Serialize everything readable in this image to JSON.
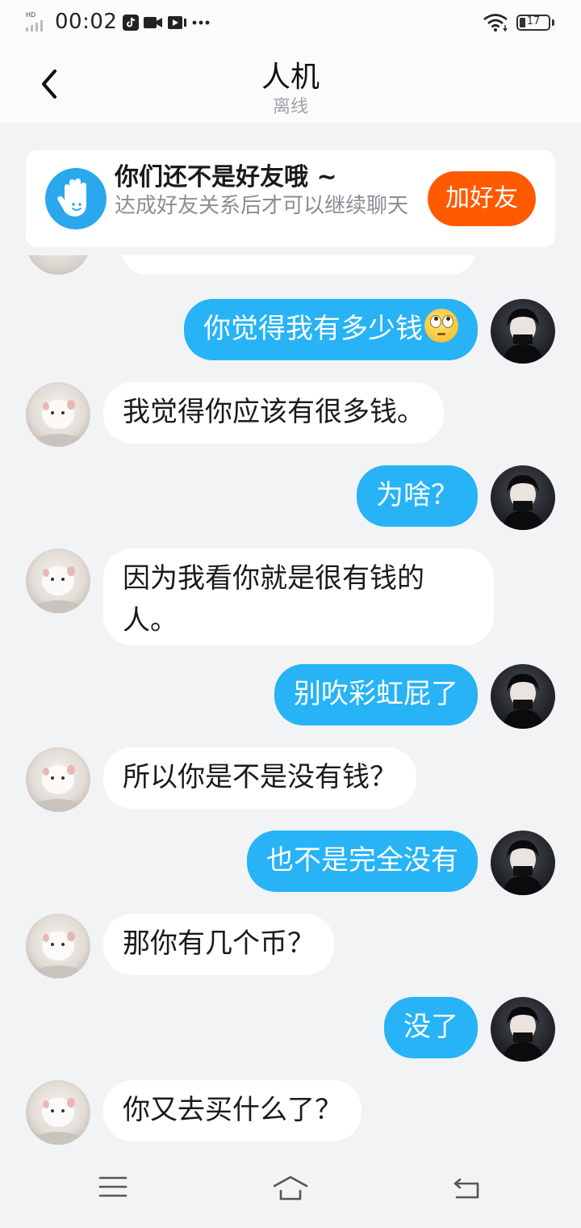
{
  "status_bar": {
    "time": "00:02",
    "network_label": "HD",
    "battery_level": "17",
    "icons": [
      "signal-icon",
      "tiktok-icon",
      "camera-icon",
      "video-icon",
      "more-dots-icon",
      "wifi-icon",
      "battery-icon"
    ]
  },
  "header": {
    "title": "人机",
    "subtitle": "离线",
    "back_icon": "chevron-left-icon"
  },
  "banner": {
    "icon": "waving-hand-icon",
    "title": "你们还不是好友哦 ~",
    "description": "达成好友关系后才可以继续聊天",
    "button_label": "加好友",
    "accent_color": "#ff5a00"
  },
  "messages": [
    {
      "sender": "self",
      "text": "你觉得我有多少钱",
      "emoji": "eye-roll-emoji"
    },
    {
      "sender": "other",
      "text": "我觉得你应该有很多钱。"
    },
    {
      "sender": "self",
      "text": "为啥？"
    },
    {
      "sender": "other",
      "text": "因为我看你就是很有钱的人。"
    },
    {
      "sender": "self",
      "text": "别吹彩虹屁了"
    },
    {
      "sender": "other",
      "text": "所以你是不是没有钱？"
    },
    {
      "sender": "self",
      "text": "也不是完全没有"
    },
    {
      "sender": "other",
      "text": "那你有几个币？"
    },
    {
      "sender": "self",
      "text": "没了"
    },
    {
      "sender": "other",
      "text": "你又去买什么了？"
    }
  ],
  "colors": {
    "self_bubble": "#27b3f5",
    "other_bubble": "#ffffff",
    "background": "#f2f3f5"
  },
  "nav_bar": {
    "icons": [
      "menu-icon",
      "home-icon",
      "back-icon"
    ]
  }
}
